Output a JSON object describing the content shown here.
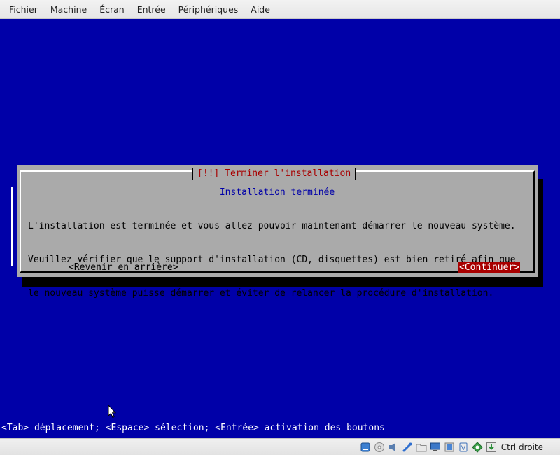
{
  "menubar": {
    "items": [
      "Fichier",
      "Machine",
      "Écran",
      "Entrée",
      "Périphériques",
      "Aide"
    ]
  },
  "dialog": {
    "title": "[!!] Terminer l'installation",
    "subtitle": "Installation terminée",
    "body_lines": [
      "L'installation est terminée et vous allez pouvoir maintenant démarrer le nouveau système.",
      "Veuillez vérifier que le support d'installation (CD, disquettes) est bien retiré afin que",
      "le nouveau système puisse démarrer et éviter de relancer la procédure d'installation."
    ],
    "back_button": "<Revenir en arrière>",
    "continue_button": "<Continuer>"
  },
  "hint_line": "<Tab> déplacement; <Espace> sélection; <Entrée> activation des boutons",
  "statusbar": {
    "icons": [
      "hard-disk-icon",
      "optical-drive-icon",
      "audio-icon",
      "usb-icon",
      "shared-folders-icon",
      "display-icon",
      "video-capture-icon",
      "network-icon",
      "mouse-integration-icon",
      "download-icon"
    ],
    "host_key": "Ctrl droite"
  },
  "colors": {
    "screen_bg": "#0000a8",
    "dialog_bg": "#aaaaaa",
    "title_color": "#a80000",
    "subtitle_color": "#0000a8",
    "button_focus_bg": "#a80000"
  }
}
